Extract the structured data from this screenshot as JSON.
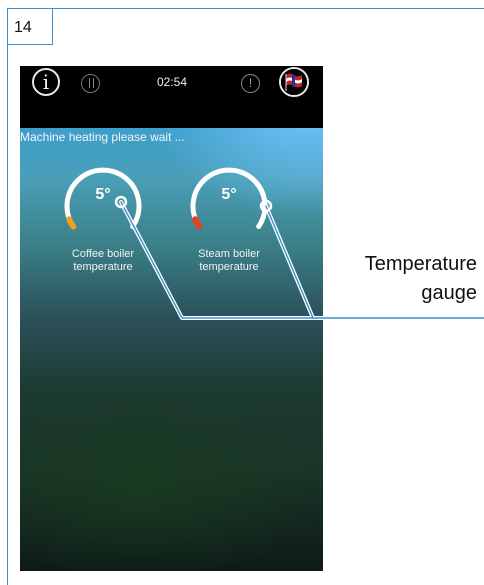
{
  "page": {
    "number": "14"
  },
  "status_bar": {
    "clock": "02:54",
    "icons": [
      "info-icon",
      "steam-icon",
      "alert-icon",
      "flag-icon"
    ]
  },
  "screen": {
    "message": "Machine heating please wait ...",
    "gauges": [
      {
        "value": "5°",
        "label_line1": "Coffee boiler",
        "label_line2": "temperature",
        "accent": "#f0a020"
      },
      {
        "value": "5°",
        "label_line1": "Steam boiler",
        "label_line2": "temperature",
        "accent": "#e8401c"
      }
    ]
  },
  "callout": {
    "line1": "Temperature",
    "line2": "gauge"
  },
  "colors": {
    "frame": "#3a8fd0",
    "screen_top": "#3a9fd2",
    "status_bar": "#000000"
  }
}
